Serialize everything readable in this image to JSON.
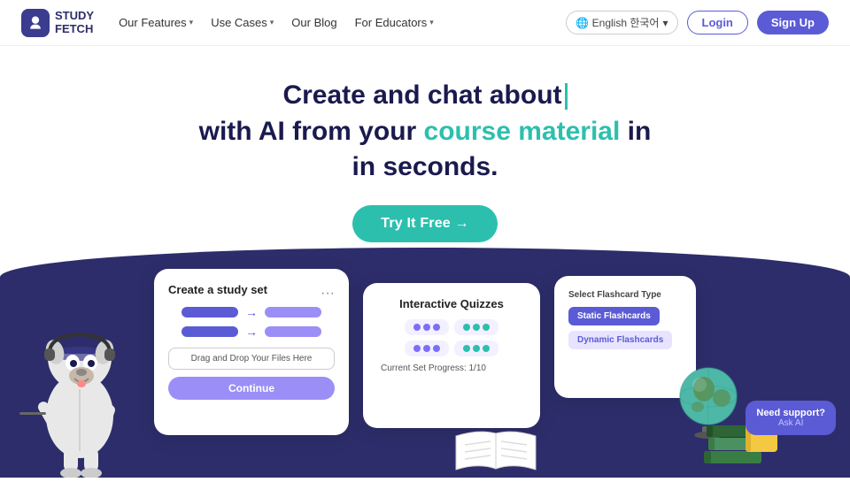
{
  "nav": {
    "logo_text_line1": "STUDY",
    "logo_text_line2": "FETCH",
    "items": [
      {
        "label": "Our Features",
        "has_dropdown": true
      },
      {
        "label": "Use Cases",
        "has_dropdown": true
      },
      {
        "label": "Our Blog",
        "has_dropdown": false
      },
      {
        "label": "For Educators",
        "has_dropdown": true
      }
    ],
    "lang_label": "🌐 English 한국어",
    "login_label": "Login",
    "signup_label": "Sign Up"
  },
  "hero": {
    "title_line1": "Create and chat about",
    "title_line2": "with AI from your",
    "title_accent": "course material",
    "title_line3": "in seconds.",
    "cta_label": "Try It Free →"
  },
  "card1": {
    "title": "Create a study set",
    "drop_text": "Drag and Drop Your Files Here",
    "btn_label": "Continue"
  },
  "card2": {
    "title": "Interactive Quizzes",
    "progress": "Current Set Progress: 1/10"
  },
  "card3": {
    "title": "Select Flashcard Type",
    "btn1": "Static Flashcards",
    "btn2": "Dynamic Flashcards"
  },
  "support": {
    "title": "Need support?",
    "sub": "Ask AI"
  },
  "colors": {
    "primary": "#5b5bd6",
    "accent": "#2dbfae",
    "dark_bg": "#2d2d6b",
    "purple_light": "#9b8ff7"
  }
}
